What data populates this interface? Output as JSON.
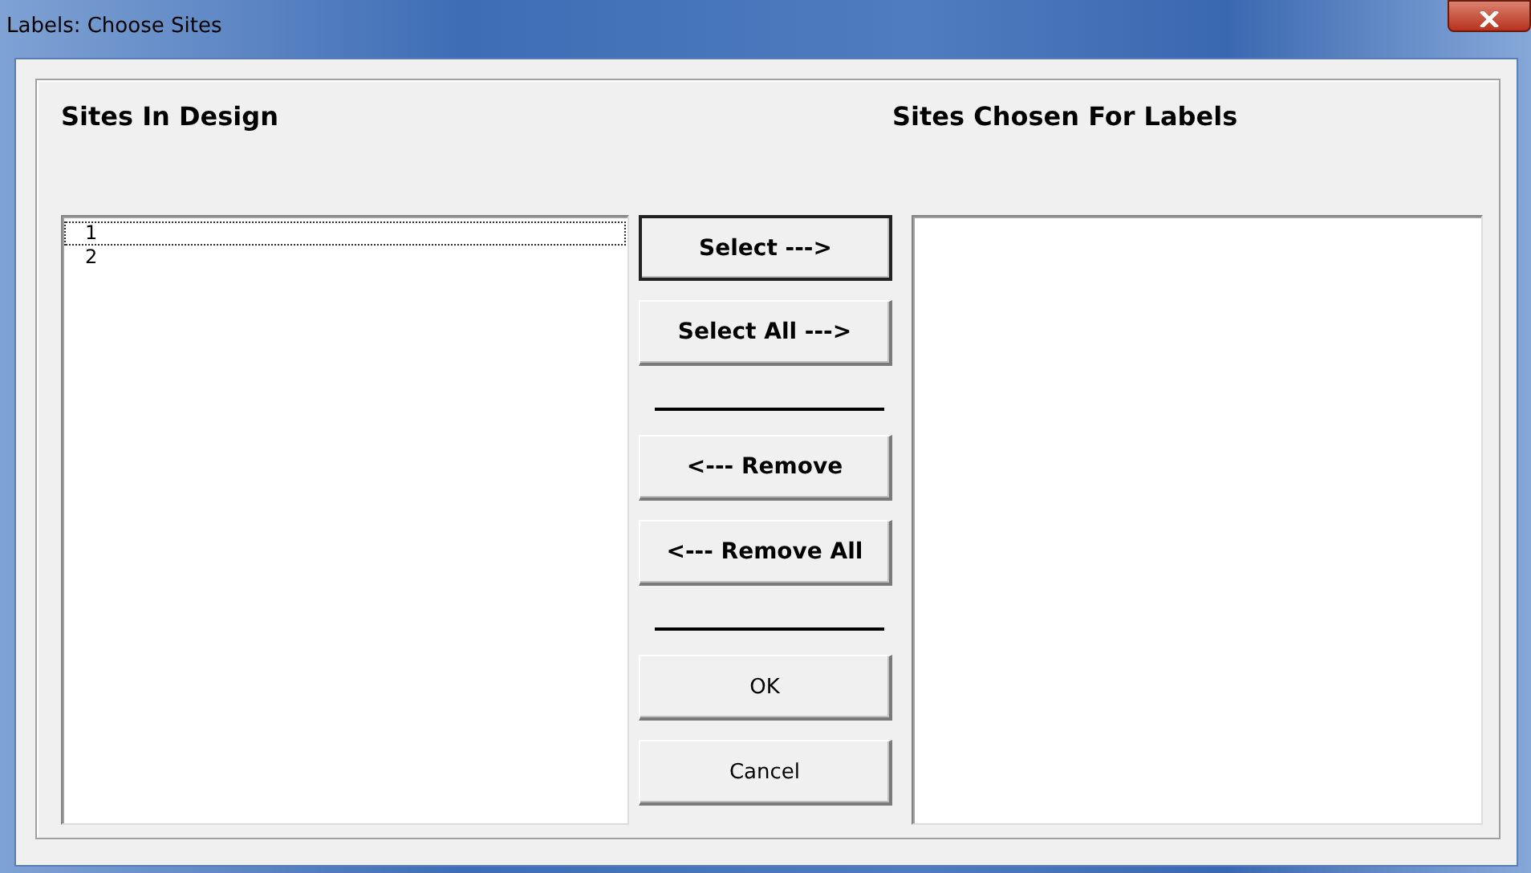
{
  "window": {
    "title": "Labels: Choose Sites"
  },
  "left": {
    "heading": "Sites In Design",
    "items": [
      {
        "label": "1",
        "focused": true
      },
      {
        "label": "2",
        "focused": false
      }
    ]
  },
  "right": {
    "heading": "Sites Chosen For Labels"
  },
  "controls": [
    {
      "kind": "button",
      "label": "Select --->",
      "bold": true,
      "default": true
    },
    {
      "kind": "button",
      "label": "Select All --->",
      "bold": true,
      "default": false
    },
    {
      "kind": "separator"
    },
    {
      "kind": "button",
      "label": "<--- Remove",
      "bold": true,
      "default": false
    },
    {
      "kind": "button",
      "label": "<--- Remove All",
      "bold": true,
      "default": false
    },
    {
      "kind": "separator"
    },
    {
      "kind": "button",
      "label": "OK",
      "bold": false,
      "default": false
    },
    {
      "kind": "button",
      "label": "Cancel",
      "bold": false,
      "default": false
    }
  ]
}
